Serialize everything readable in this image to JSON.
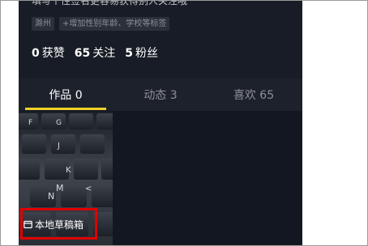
{
  "profile": {
    "bio_clipped": "填写个性签名更容易获得别人关注哦",
    "tags": [
      "滁州",
      "+增加性别年龄、学校等标签"
    ],
    "stats": [
      {
        "num": "0",
        "label": "获赞"
      },
      {
        "num": "65",
        "label": "关注"
      },
      {
        "num": "5",
        "label": "粉丝"
      }
    ]
  },
  "tabs": [
    {
      "label": "作品 0",
      "active": true
    },
    {
      "label": "动态 3",
      "active": false
    },
    {
      "label": "喜欢 65",
      "active": false
    }
  ],
  "grid": {
    "draft_label": "本地草稿箱",
    "keys": [
      "F",
      "G",
      "J",
      "K",
      "N",
      "M",
      "<"
    ]
  },
  "colors": {
    "accent": "#f1cf27",
    "highlight": "#e10000"
  }
}
